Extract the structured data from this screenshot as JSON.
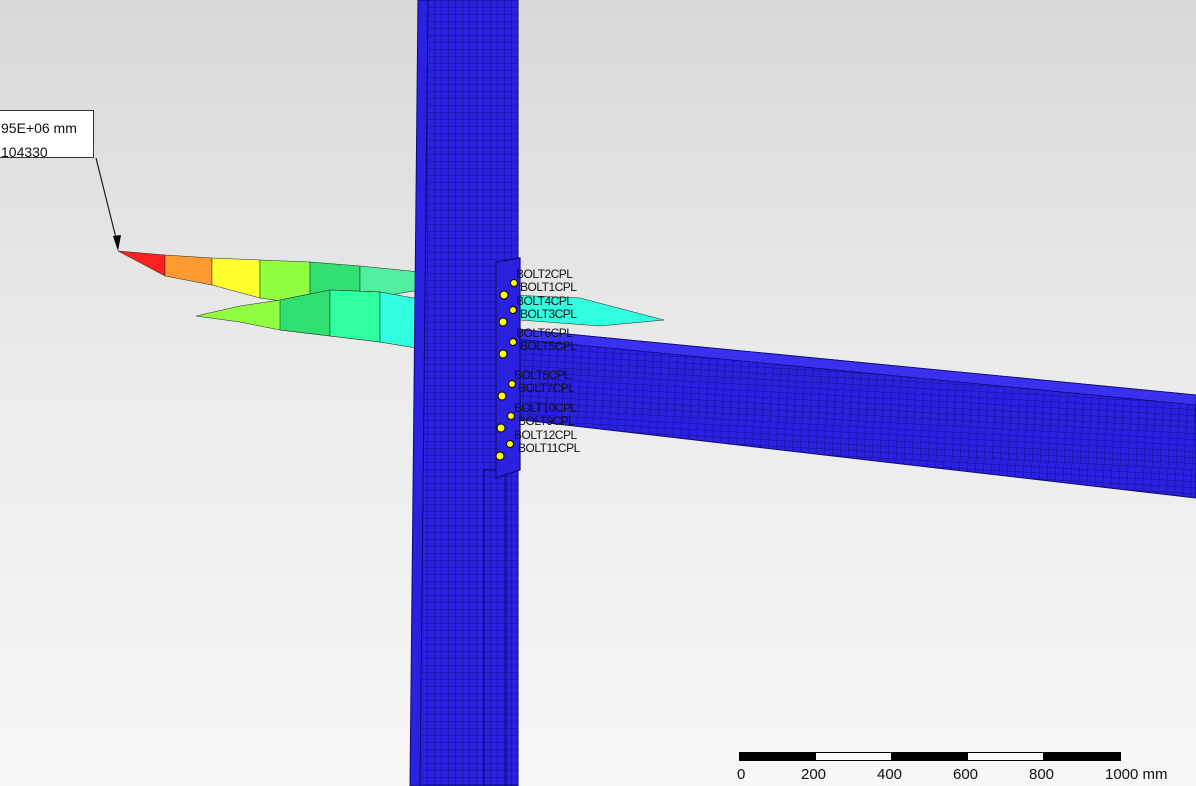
{
  "probe": {
    "line1": "95E+06 mm",
    "line2": "104330"
  },
  "bolt_labels": [
    "BOLT2CPL",
    "BOLT1CPL",
    "BOLT4CPL",
    "BOLT3CPL",
    "BOLT6CPL",
    "BOLT5CPL",
    "BOLT8CPL",
    "BOLT7CPL",
    "BOLT10CPL",
    "BOLT9CPL",
    "BOLT12CPL",
    "BOLT11CPL"
  ],
  "scale_bar": {
    "ticks": [
      "0",
      "200",
      "400",
      "600",
      "800",
      "1000 mm"
    ]
  },
  "colors": {
    "mesh_blue": "#2a22e0",
    "mesh_line": "#0d0a70",
    "bolt_yellow": "#ffff00",
    "contour": [
      "#ff2020",
      "#ff9a30",
      "#ffff30",
      "#90ff40",
      "#30e070",
      "#30ffe0",
      "#40c8ff",
      "#3a7cff"
    ]
  }
}
